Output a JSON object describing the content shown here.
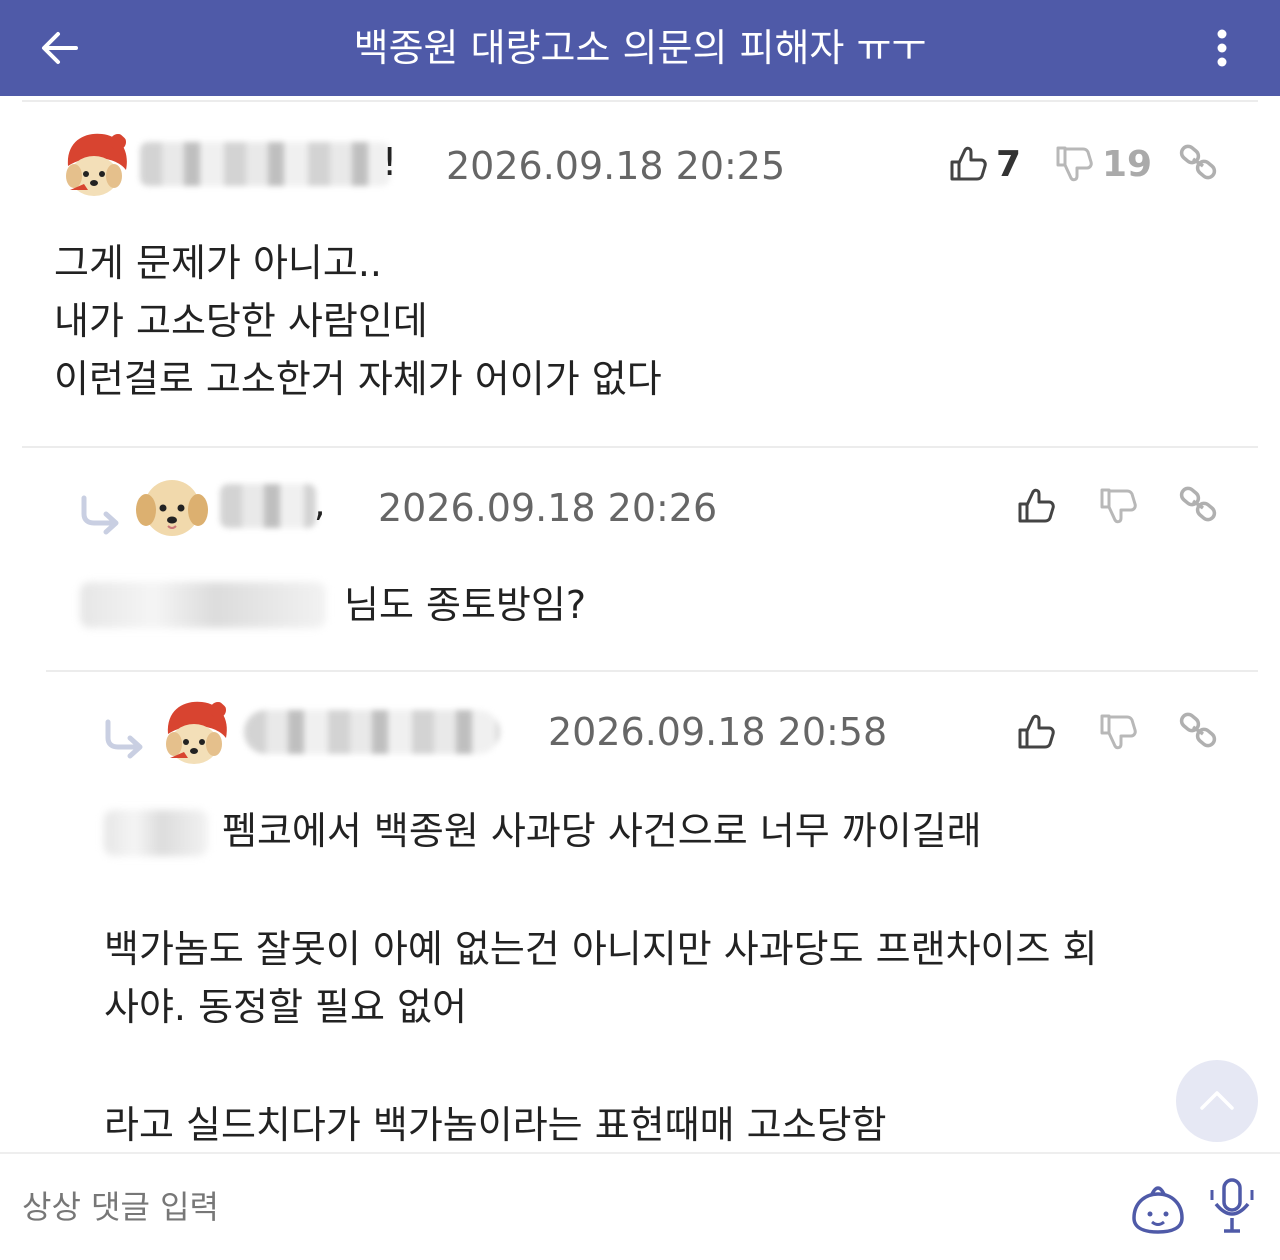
{
  "header": {
    "title": "백종원 대량고소 의문의 피해자 ㅠㅜ",
    "back_icon": "arrow-left-icon",
    "more_icon": "more-vertical-icon",
    "background": "#4f5aa8"
  },
  "comments": [
    {
      "nickname_tail": "!",
      "time": "2026.09.18 20:25",
      "likes": "7",
      "dislikes": "19",
      "text_lines": [
        "그게 문제가 아니고..",
        "내가 고소당한 사람인데",
        "이런걸로 고소한거 자체가 어이가 없다"
      ]
    },
    {
      "nickname_tail": ",",
      "time": "2026.09.18 20:26",
      "text": "님도 종토방임?"
    },
    {
      "time": "2026.09.18 20:58",
      "line1": "펨코에서 백종원 사과당 사건으로 너무 까이길래",
      "line2": "백가놈도 잘못이 아예 없는건 아니지만 사과당도 프랜차이즈 회",
      "line3": "사야. 동정할 필요 없어",
      "line4": "라고 실드치다가 백가놈이라는 표현때매 고소당함"
    }
  ],
  "footer": {
    "placeholder": "상상 댓글 입력"
  },
  "icons": [
    "thumbs-up-icon",
    "thumbs-down-icon",
    "link-icon",
    "reply-arrow-icon",
    "chevron-up-icon",
    "emoji-icon",
    "mic-icon"
  ],
  "colors": {
    "accent": "#4f5aa8",
    "scroll_button": "#e6e8f4"
  }
}
